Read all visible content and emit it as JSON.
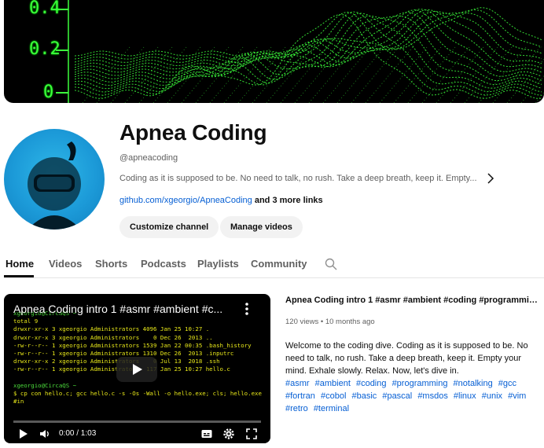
{
  "banner": {
    "axis_labels": [
      "0.4",
      "0.2",
      "0"
    ]
  },
  "channel": {
    "name": "Apnea Coding",
    "handle": "@apneacoding",
    "description": "Coding as it is supposed to be. No need to talk, no rush. Take a deep breath, keep it. Empty...",
    "link": "github.com/xgeorgio/ApneaCoding",
    "more_links": "and 3 more links",
    "customize_label": "Customize channel",
    "manage_label": "Manage videos"
  },
  "tabs": [
    {
      "label": "Home",
      "active": true
    },
    {
      "label": "Videos"
    },
    {
      "label": "Shorts"
    },
    {
      "label": "Podcasts"
    },
    {
      "label": "Playlists"
    },
    {
      "label": "Community"
    }
  ],
  "player": {
    "title": "Apnea Coding intro 1 #asmr #ambient #c...",
    "time": "0:00 / 1:03",
    "progress_fraction": 0.0,
    "terminal_lines": [
      "xgeorgio@CircaQS ~",
      "total 9",
      "drwxr-xr-x 3 xgeorgio Administrators 4096 Jan 25 10:27 .",
      "drwxr-xr-x 3 xgeorgio Administrators    0 Dec 26  2013 ..",
      "-rw-r--r-- 1 xgeorgio Administrators 1539 Jan 22 00:35 .bash_history",
      "-rw-r--r-- 1 xgeorgio Administrators 1310 Dec 26  2013 .inputrc",
      "drwxr-xr-x 2 xgeorgio Administrators    0 Jul 13  2018 .ssh",
      "-rw-r--r-- 1 xgeorgio Administrators  117 Jan 25 10:27 hello.c",
      "",
      "xgeorgio@CircaQS ~",
      "$ cp con hello.c; gcc hello.c -s -Os -Wall -o hello.exe; cls; hello.exe",
      "#in"
    ]
  },
  "video": {
    "title": "Apnea Coding intro 1 #asmr #ambient #coding #programming...",
    "meta": "120 views • 10 months ago",
    "description": "Welcome to the coding dive. Coding as it is supposed to be. No need to talk, no rush. Take a deep breath, keep it. Empty your mind. Exhale slowly. Relax. Now, let's dive in.",
    "tags": [
      "#asmr",
      "#ambient",
      "#coding",
      "#programming",
      "#notalking",
      "#gcc",
      "#fortran",
      "#cobol",
      "#basic",
      "#pascal",
      "#msdos",
      "#linux",
      "#unix",
      "#vim",
      "#retro",
      "#terminal"
    ]
  },
  "icons": {
    "search": "search-icon",
    "chevron": "chevron-right-icon",
    "more": "more-vert-icon",
    "play": "play-icon",
    "volume": "volume-icon",
    "captions": "captions-icon",
    "settings": "gear-icon",
    "fullscreen": "fullscreen-icon"
  },
  "colors": {
    "link": "#065fd4",
    "progress": "#ff0000",
    "terminal_green": "#3cff3c"
  }
}
